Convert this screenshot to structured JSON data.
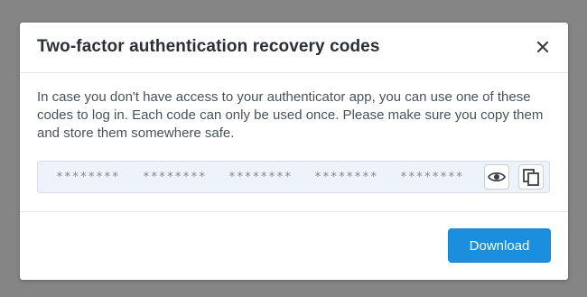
{
  "modal": {
    "title": "Two-factor authentication recovery codes",
    "description": "In case you don't have access to your authenticator app, you can use one of these codes to log in. Each code can only be used once. Please make sure you copy them and store them somewhere safe.",
    "codes": [
      "********",
      "********",
      "********",
      "********",
      "********"
    ],
    "close_icon": "close-icon",
    "show_icon": "eye-icon",
    "copy_icon": "copy-icon",
    "download_label": "Download"
  },
  "colors": {
    "backdrop": "#858585",
    "primary": "#1b8fde",
    "codes_background": "#eef2fb"
  }
}
